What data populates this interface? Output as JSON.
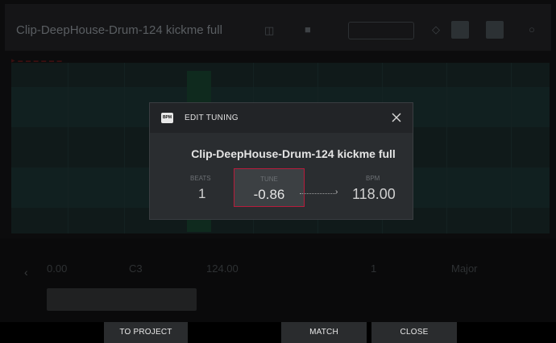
{
  "background": {
    "clip_title": "Clip-DeepHouse-Drum-124 kickme full",
    "param_values": [
      "0.00",
      "C3",
      "124.00",
      "1",
      "Major"
    ]
  },
  "modal": {
    "icon": "BPM",
    "title": "EDIT TUNING",
    "clip_name": "Clip-DeepHouse-Drum-124 kickme full",
    "beats": {
      "label": "BEATS",
      "value": "1"
    },
    "tune": {
      "label": "TUNE",
      "value": "-0.86"
    },
    "bpm": {
      "label": "BPM",
      "value": "118.00"
    },
    "close_icon": "close-icon"
  },
  "footer": {
    "to_project": "TO PROJECT",
    "match": "MATCH",
    "close": "CLOSE"
  },
  "colors": {
    "tune_border": "#b81c3c",
    "modal_bg": "#2a2d30"
  }
}
